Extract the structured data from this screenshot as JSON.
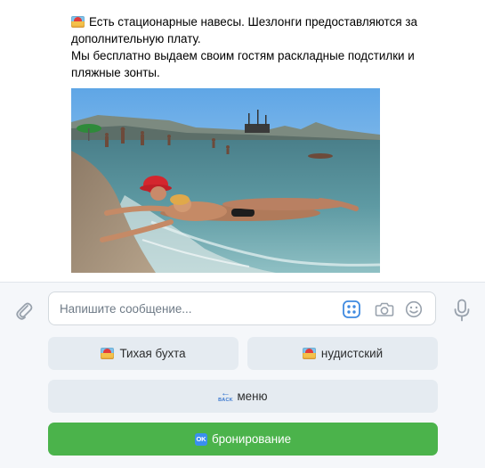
{
  "message": {
    "lines": [
      "Есть стационарные навесы. Шезлонги предоставляются за",
      "дополнительную плату.",
      "Мы бесплатно выдаем своим гостям раскладные подстилки и",
      "пляжные зонты."
    ],
    "lead_emoji": "beach-umbrella-icon",
    "photo": "beach-photo"
  },
  "composer": {
    "placeholder": "Напишите сообщение...",
    "icons": [
      "paperclip-icon",
      "bot-keyboard-icon",
      "camera-icon",
      "smile-icon",
      "microphone-icon"
    ]
  },
  "keyboard": {
    "buttons": [
      {
        "label": "Тихая бухта",
        "icon": "beach-umbrella-icon",
        "color": "#e5ebf1"
      },
      {
        "label": "нудистский",
        "icon": "beach-umbrella-icon",
        "color": "#e5ebf1"
      },
      {
        "label": "меню",
        "icon": "back-arrow-icon",
        "icon_text": "BACK",
        "color": "#e5ebf1"
      },
      {
        "label": "бронирование",
        "icon": "ok-icon",
        "icon_text": "OK",
        "color": "#4bb34b"
      }
    ]
  },
  "colors": {
    "accent": "#4bb34b",
    "secondary_button": "#e5ebf1",
    "icon_gray": "#99a2ad",
    "keyboard_icon_blue": "#3f8ae0"
  }
}
